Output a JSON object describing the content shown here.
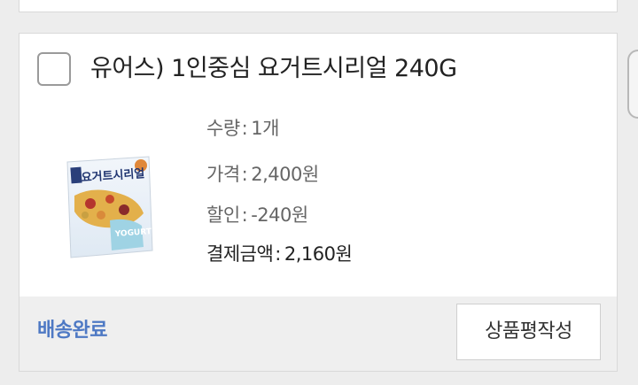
{
  "order_item": {
    "title": "유어스) 1인중심 요거트시리얼 240G",
    "product_image": {
      "headline": "요거트시리얼",
      "badge": "YOGURT"
    },
    "details": [
      {
        "label": "수량",
        "value": "1개"
      },
      {
        "label": "가격",
        "value": "2,400원"
      },
      {
        "label": "할인",
        "value": "-240원"
      },
      {
        "label": "결제금액",
        "value": "2,160원"
      }
    ],
    "separator": ":",
    "status": "배송완료",
    "review_button": "상품평작성"
  },
  "colors": {
    "status": "#4e79c4",
    "background": "#ededed",
    "card": "#ffffff",
    "footer": "#efefef"
  },
  "icons": {
    "checkbox": "checkbox-unchecked-icon"
  }
}
